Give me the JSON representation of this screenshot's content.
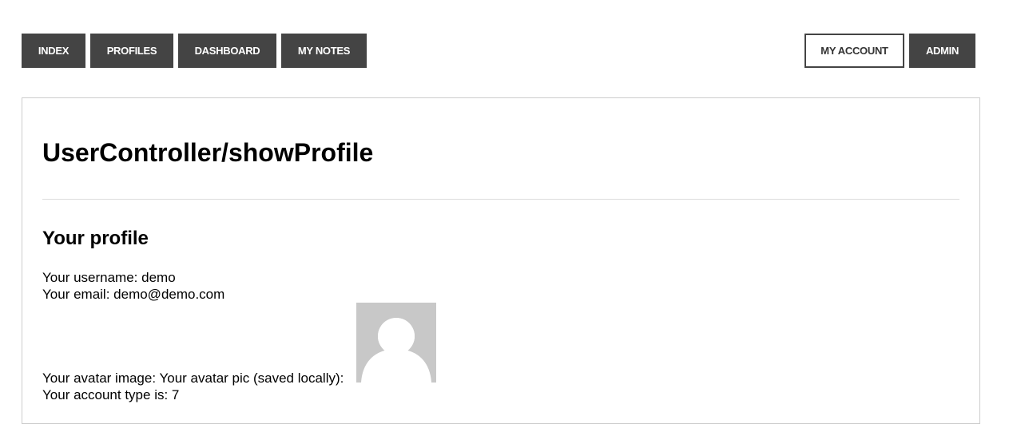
{
  "nav": {
    "left": {
      "index": "INDEX",
      "profiles": "PROFILES",
      "dashboard": "DASHBOARD",
      "my_notes": "MY NOTES"
    },
    "right": {
      "my_account": "MY ACCOUNT",
      "admin": "ADMIN"
    }
  },
  "main": {
    "page_title": "UserController/showProfile",
    "section_title": "Your profile",
    "username_label": "Your username: ",
    "username_value": "demo",
    "email_label": "Your email: ",
    "email_value": "demo@demo.com",
    "avatar_label": "Your avatar image: Your avatar pic (saved locally):",
    "account_type_label": "Your account type is: ",
    "account_type_value": "7"
  },
  "colors": {
    "nav_bg": "#444444",
    "avatar_bg": "#c8c8c8",
    "avatar_figure": "#ffffff"
  },
  "icons": {
    "avatar": "default-user-avatar-icon"
  }
}
